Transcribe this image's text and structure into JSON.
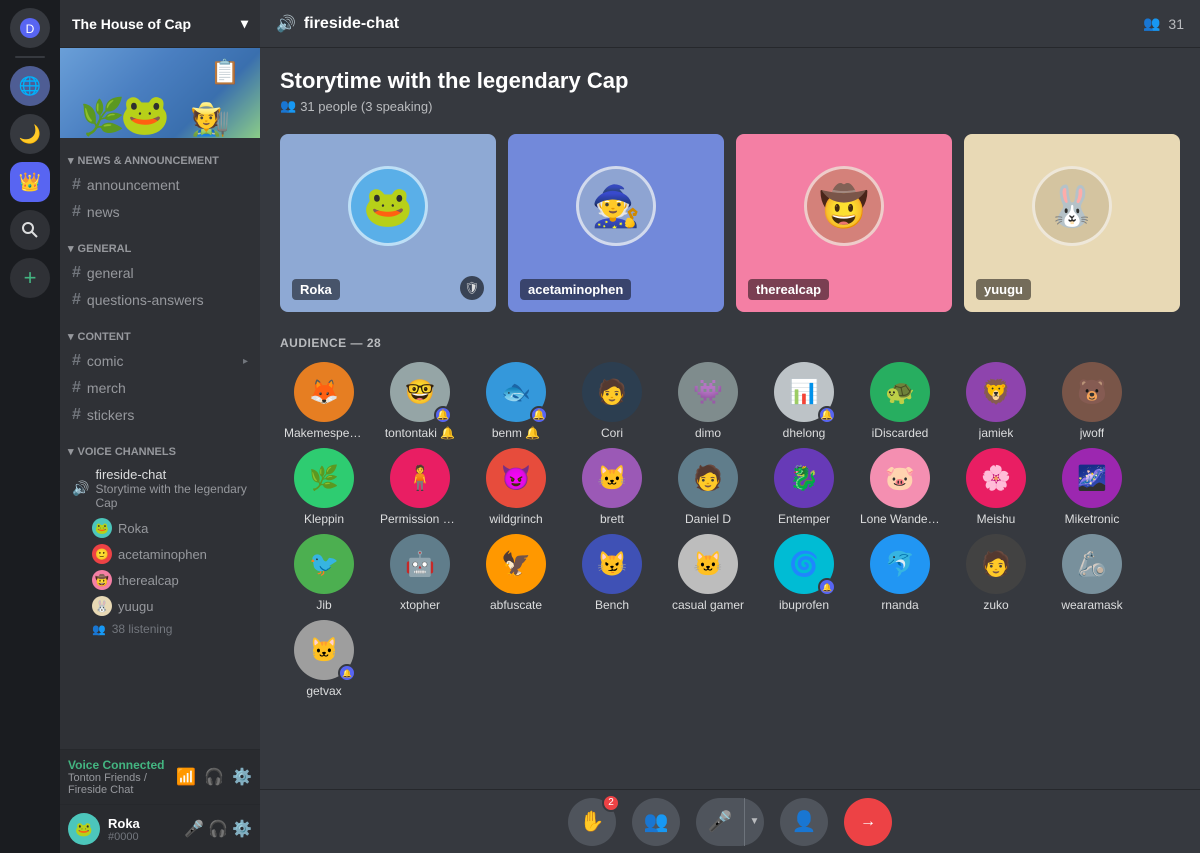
{
  "app": {
    "title": "DISCORD"
  },
  "server": {
    "name": "The House of Cap",
    "chevron": "▾"
  },
  "channels": {
    "sections": [
      {
        "label": "NEWS & ANNOUNCEMENT",
        "items": [
          {
            "name": "announcement",
            "type": "text"
          },
          {
            "name": "news",
            "type": "text"
          }
        ]
      },
      {
        "label": "GENERAL",
        "items": [
          {
            "name": "general",
            "type": "text"
          },
          {
            "name": "questions-answers",
            "type": "text"
          }
        ]
      },
      {
        "label": "CONTENT",
        "items": [
          {
            "name": "comic",
            "type": "text"
          },
          {
            "name": "merch",
            "type": "text"
          },
          {
            "name": "stickers",
            "type": "text"
          }
        ]
      }
    ],
    "voiceSection": {
      "label": "VOICE CHANNELS",
      "channels": [
        {
          "name": "fireside-chat",
          "subtitle": "Storytime with the legendary Cap",
          "users": [
            "Roka",
            "acetaminophen",
            "therealcap",
            "yuugu"
          ],
          "listeners": "38 listening"
        }
      ]
    }
  },
  "voiceConnected": {
    "label": "Voice Connected",
    "server": "Tonton Friends / Fireside Chat"
  },
  "currentUser": {
    "name": "Roka",
    "tag": "#0000",
    "emoji": "🐸"
  },
  "channelHeader": {
    "name": "fireside-chat",
    "memberCount": "31"
  },
  "stage": {
    "title": "Storytime with the legendary Cap",
    "subtitle": "31 people (3 speaking)",
    "speakers": [
      {
        "name": "Roka",
        "color": "blue",
        "emoji": "🐸",
        "mod": true
      },
      {
        "name": "acetaminophen",
        "color": "indigo",
        "emoji": "🧙",
        "mod": false
      },
      {
        "name": "therealcap",
        "color": "pink",
        "emoji": "🤠",
        "mod": false
      },
      {
        "name": "yuugu",
        "color": "cream",
        "emoji": "🐰",
        "mod": false
      }
    ],
    "audienceLabel": "AUDIENCE — 28",
    "audience": [
      {
        "name": "Makemespeakrr",
        "emoji": "🦊",
        "color": "#e67e22",
        "badge": ""
      },
      {
        "name": "tontontaki",
        "emoji": "🤓",
        "color": "#95a5a6",
        "badge": "🔔"
      },
      {
        "name": "benm",
        "emoji": "🐟",
        "color": "#3498db",
        "badge": "🔔"
      },
      {
        "name": "Cori",
        "emoji": "🧑",
        "color": "#2c3e50",
        "badge": ""
      },
      {
        "name": "dimo",
        "emoji": "👾",
        "color": "#7f8c8d",
        "badge": ""
      },
      {
        "name": "dhelong",
        "emoji": "📊",
        "color": "#bdc3c7",
        "badge": "🔔"
      },
      {
        "name": "iDiscarded",
        "emoji": "🐢",
        "color": "#27ae60",
        "badge": ""
      },
      {
        "name": "jamiek",
        "emoji": "🦁",
        "color": "#8e44ad",
        "badge": ""
      },
      {
        "name": "jwoff",
        "emoji": "🐻",
        "color": "#795548",
        "badge": ""
      },
      {
        "name": "Kleppin",
        "emoji": "🌿",
        "color": "#2ecc71",
        "badge": ""
      },
      {
        "name": "Permission Man",
        "emoji": "🧍",
        "color": "#e91e63",
        "badge": ""
      },
      {
        "name": "wildgrinch",
        "emoji": "😈",
        "color": "#e74c3c",
        "badge": ""
      },
      {
        "name": "brett",
        "emoji": "🐱",
        "color": "#9b59b6",
        "badge": ""
      },
      {
        "name": "Daniel D",
        "emoji": "🧑‍🦱",
        "color": "#607d8b",
        "badge": ""
      },
      {
        "name": "Entemper",
        "emoji": "🐉",
        "color": "#673ab7",
        "badge": ""
      },
      {
        "name": "Lone Wanderer",
        "emoji": "🐷",
        "color": "#f48fb1",
        "badge": ""
      },
      {
        "name": "Meishu",
        "emoji": "🌸",
        "color": "#e91e63",
        "badge": ""
      },
      {
        "name": "Miketronic",
        "emoji": "🌌",
        "color": "#9c27b0",
        "badge": ""
      },
      {
        "name": "Jib",
        "emoji": "🐦",
        "color": "#4caf50",
        "badge": ""
      },
      {
        "name": "xtopher",
        "emoji": "🤖",
        "color": "#607d8b",
        "badge": ""
      },
      {
        "name": "abfuscate",
        "emoji": "🦅",
        "color": "#ff9800",
        "badge": ""
      },
      {
        "name": "Bench",
        "emoji": "😼",
        "color": "#3f51b5",
        "badge": ""
      },
      {
        "name": "casual gamer",
        "emoji": "🐱",
        "color": "#e0e0e0",
        "badge": ""
      },
      {
        "name": "ibuprofen",
        "emoji": "🌀",
        "color": "#00bcd4",
        "badge": "🔔"
      },
      {
        "name": "rnanda",
        "emoji": "🐬",
        "color": "#2196f3",
        "badge": ""
      },
      {
        "name": "zuko",
        "emoji": "🧑",
        "color": "#424242",
        "badge": ""
      },
      {
        "name": "wearamask",
        "emoji": "🦾",
        "color": "#78909c",
        "badge": ""
      },
      {
        "name": "getvax",
        "emoji": "🐱",
        "color": "#9e9e9e",
        "badge": "🔔"
      }
    ]
  },
  "controls": {
    "raise_hand": "✋",
    "raise_hand_badge": "2",
    "invite": "👥",
    "mic": "🎤",
    "add_speaker": "👤+",
    "leave": "→"
  }
}
